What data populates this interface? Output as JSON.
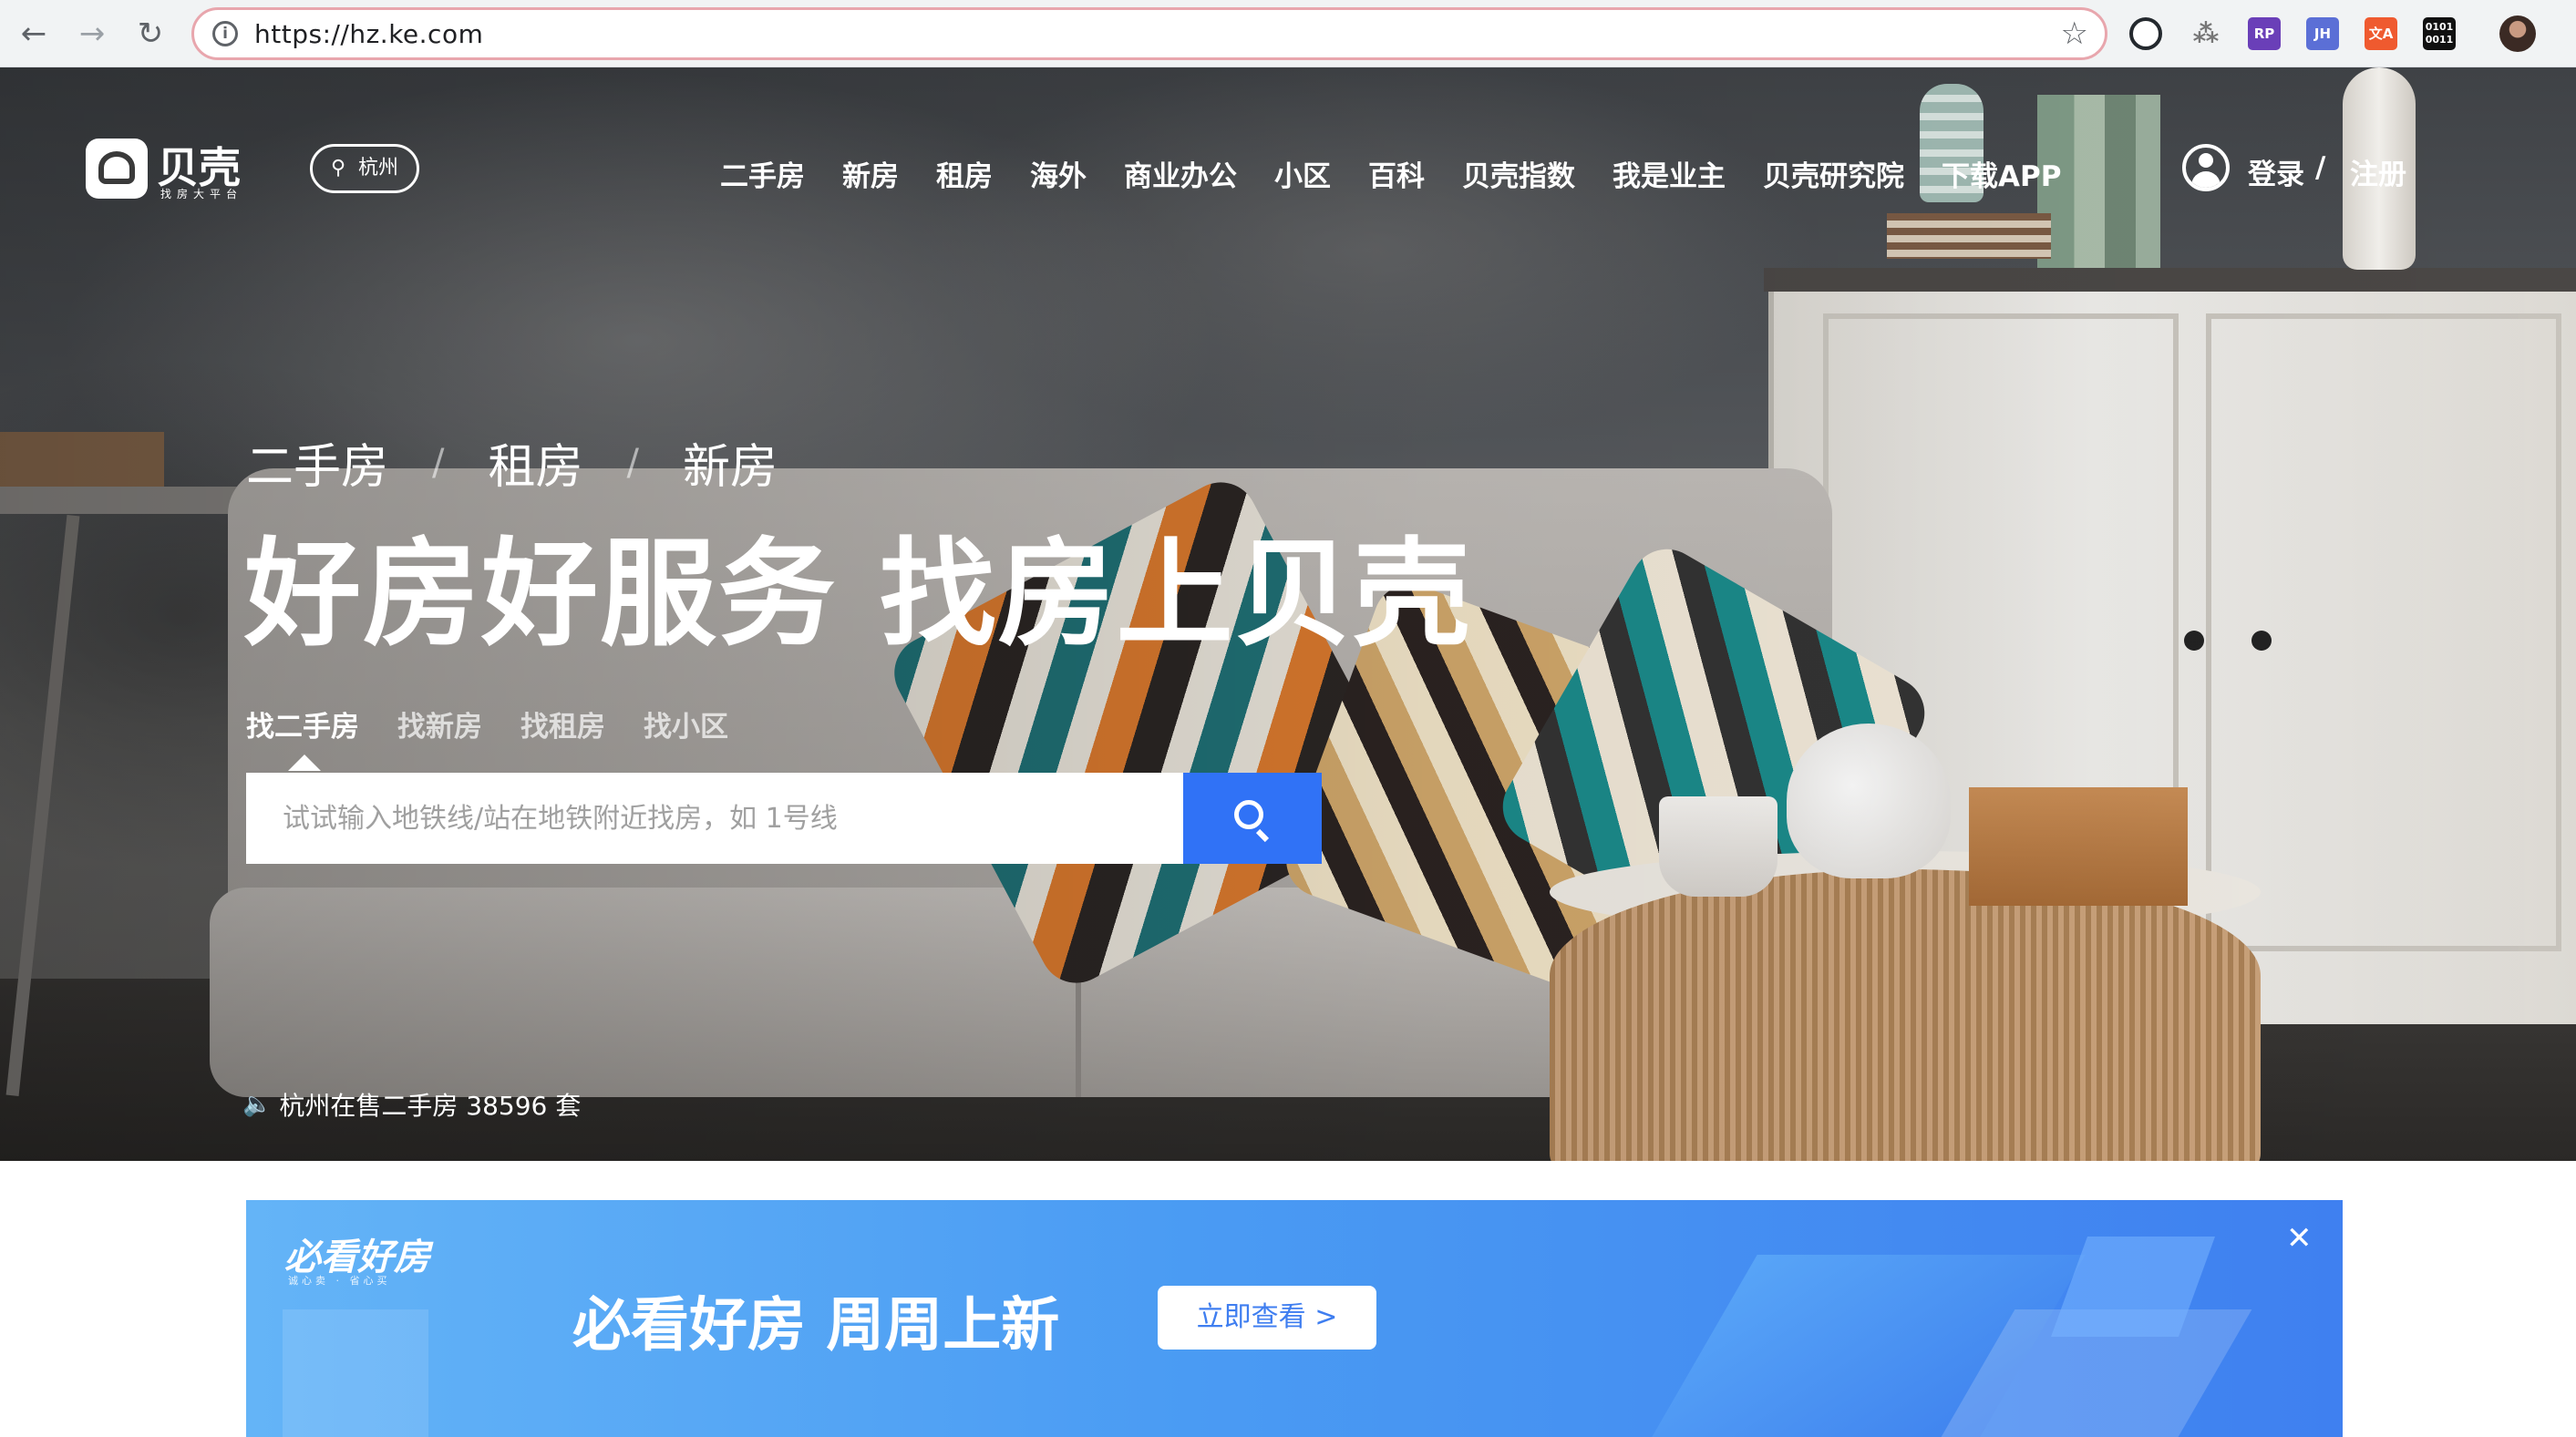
{
  "browser": {
    "back_icon": "←",
    "forward_icon": "→",
    "reload_icon": "↻",
    "url": "https://hz.ke.com",
    "info_icon": "i",
    "bookmark_icon": "☆",
    "extensions": [
      "",
      "⁂",
      "RP",
      "JH",
      "文A",
      "0101 0011"
    ]
  },
  "site": {
    "logo_text": "贝壳",
    "logo_sub": "找房大平台",
    "city": "杭州",
    "nav": [
      "二手房",
      "新房",
      "租房",
      "海外",
      "商业办公",
      "小区",
      "百科",
      "贝壳指数",
      "我是业主",
      "贝壳研究院",
      "下载APP"
    ],
    "login": "登录",
    "slash": "/",
    "register": "注册"
  },
  "hero": {
    "categories": [
      "二手房",
      "/",
      "租房",
      "/",
      "新房"
    ],
    "headline": "好房好服务 找房上贝壳",
    "search_tabs": [
      "找二手房",
      "找新房",
      "找租房",
      "找小区"
    ],
    "search_placeholder": "试试输入地铁线/站在地铁附近找房，如 1号线",
    "ticker_icon": "🔈",
    "ticker": "杭州在售二手房 38596 套"
  },
  "banner": {
    "logo": "必看好房",
    "logo_sub": "诚心卖 · 省心买",
    "title": "必看好房  周周上新",
    "button": "立即查看 >",
    "close_icon": "✕"
  },
  "colors": {
    "accent_blue": "#3072f6",
    "banner_start": "#64b4f7",
    "banner_end": "#3f80f0"
  }
}
